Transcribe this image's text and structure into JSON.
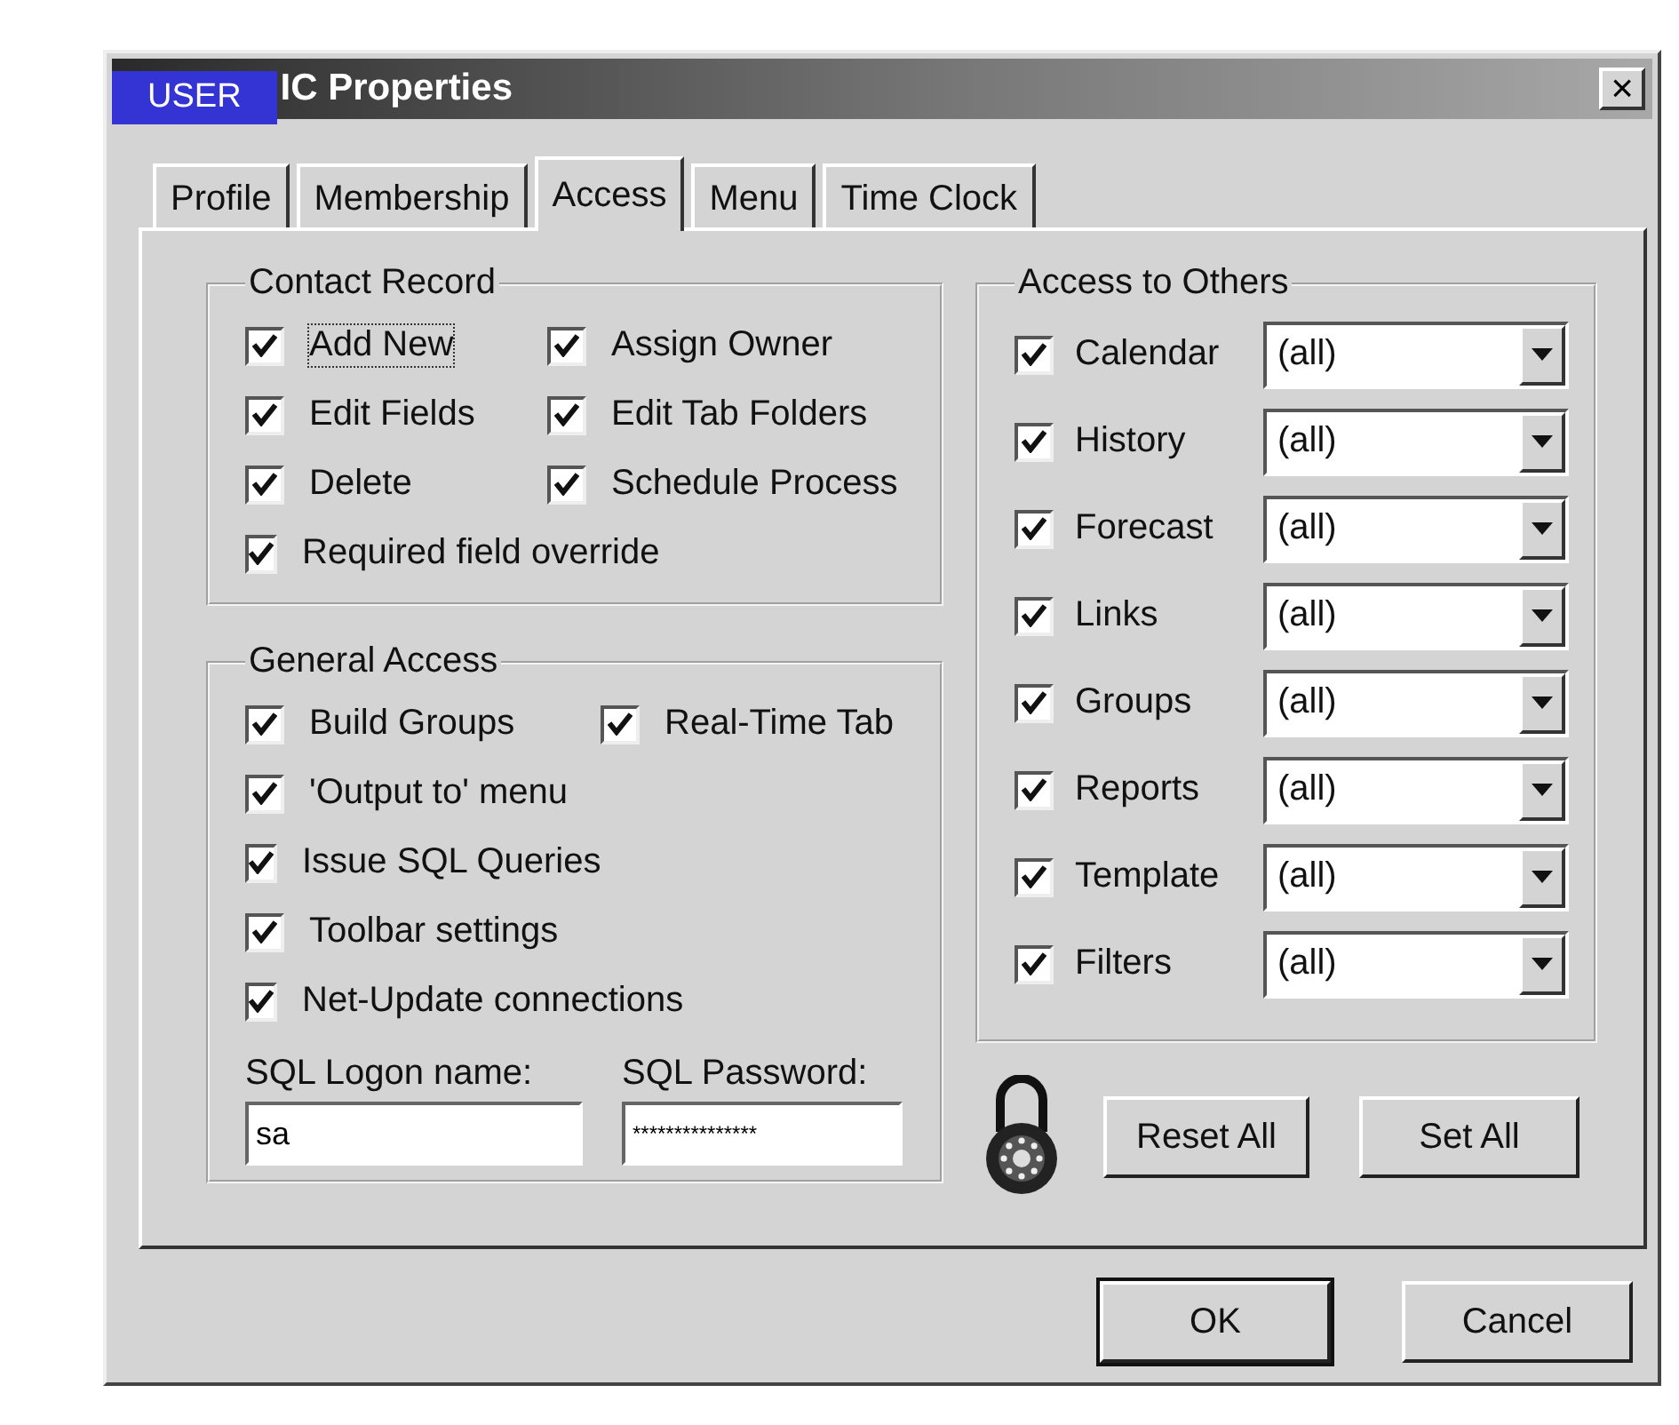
{
  "window": {
    "badge": "USER",
    "title": "IC Properties",
    "close": "×"
  },
  "tabs": [
    {
      "label": "Profile",
      "selected": false
    },
    {
      "label": "Membership",
      "selected": false
    },
    {
      "label": "Access",
      "selected": true
    },
    {
      "label": "Menu",
      "selected": false
    },
    {
      "label": "Time Clock",
      "selected": false
    }
  ],
  "contact_record": {
    "title": "Contact Record",
    "rows": [
      [
        {
          "label": "Add New",
          "checked": true,
          "focused": true
        },
        {
          "label": "Assign Owner",
          "checked": true,
          "focused": false
        }
      ],
      [
        {
          "label": "Edit Fields",
          "checked": true,
          "focused": false
        },
        {
          "label": "Edit Tab Folders",
          "checked": true,
          "focused": false
        }
      ],
      [
        {
          "label": "Delete",
          "checked": true,
          "focused": false
        },
        {
          "label": "Schedule Process",
          "checked": true,
          "focused": false
        }
      ],
      [
        {
          "label": "Required field override",
          "checked": true,
          "focused": false
        }
      ]
    ]
  },
  "general_access": {
    "title": "General Access",
    "rows": [
      [
        {
          "label": "Build Groups",
          "checked": true,
          "focused": false
        },
        {
          "label": "Real-Time Tab",
          "checked": true,
          "focused": false
        }
      ],
      [
        {
          "label": "'Output to' menu",
          "checked": true,
          "focused": false
        }
      ],
      [
        {
          "label": "Issue SQL Queries",
          "checked": true,
          "focused": false
        }
      ],
      [
        {
          "label": "Toolbar settings",
          "checked": true,
          "focused": false
        }
      ],
      [
        {
          "label": "Net-Update connections",
          "checked": true,
          "focused": false
        }
      ]
    ],
    "fields": [
      {
        "label": "SQL Logon name:",
        "value": "sa"
      },
      {
        "label": "SQL Password:",
        "value": "***************"
      }
    ]
  },
  "access_to_others": {
    "title": "Access to Others",
    "rows": [
      {
        "label": "Calendar",
        "checked": true,
        "value": "(all)"
      },
      {
        "label": "History",
        "checked": true,
        "value": "(all)"
      },
      {
        "label": "Forecast",
        "checked": true,
        "value": "(all)"
      },
      {
        "label": "Links",
        "checked": true,
        "value": "(all)"
      },
      {
        "label": "Groups",
        "checked": true,
        "value": "(all)"
      },
      {
        "label": "Reports",
        "checked": true,
        "value": "(all)"
      },
      {
        "label": "Template",
        "checked": true,
        "value": "(all)"
      },
      {
        "label": "Filters",
        "checked": true,
        "value": "(all)"
      }
    ]
  },
  "panel_buttons": [
    {
      "label": "Reset All",
      "default": false
    },
    {
      "label": "Set All",
      "default": false
    }
  ],
  "buttons": [
    {
      "label": "OK",
      "default": true
    },
    {
      "label": "Cancel",
      "default": false
    }
  ]
}
